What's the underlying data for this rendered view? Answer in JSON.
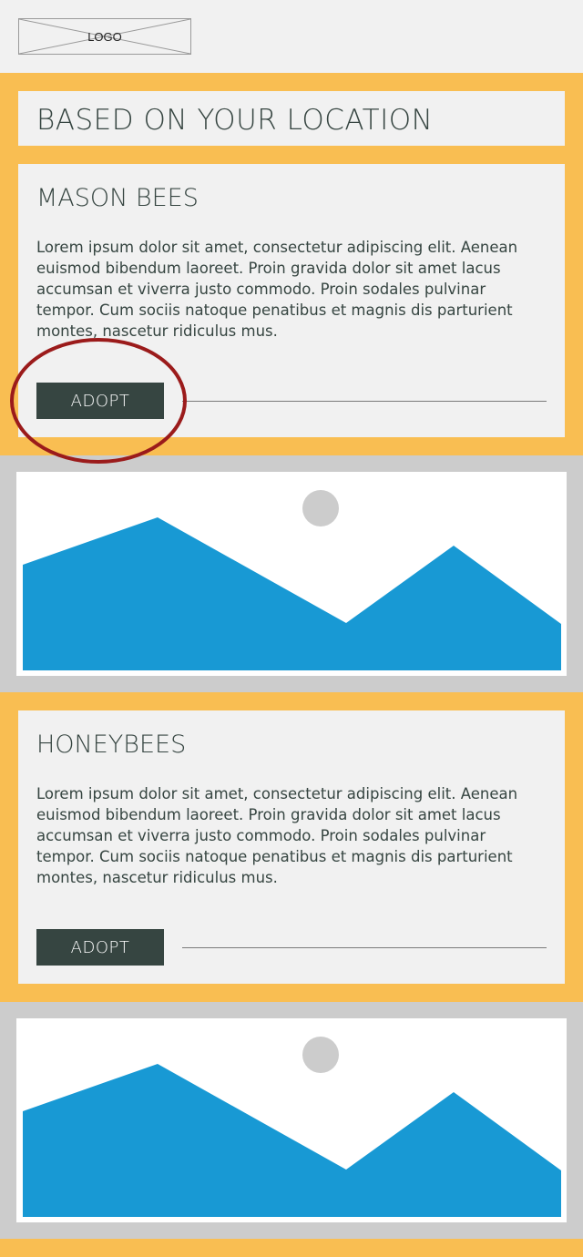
{
  "header": {
    "logo_text": "LOGO"
  },
  "section": {
    "title": "BASED ON YOUR LOCATION"
  },
  "cards": [
    {
      "title": "MASON BEES",
      "body": "Lorem ipsum dolor sit amet, consectetur adipiscing elit. Aenean euismod bibendum laoreet. Proin gravida dolor sit amet lacus accumsan et viverra justo commodo. Proin sodales pulvinar tempor. Cum sociis natoque penatibus et magnis dis parturient montes, nascetur ridiculus mus.",
      "button_label": "ADOPT",
      "highlighted": true
    },
    {
      "title": "HONEYBEES",
      "body": "Lorem ipsum dolor sit amet, consectetur adipiscing elit. Aenean euismod bibendum laoreet. Proin gravida dolor sit amet lacus accumsan et viverra justo commodo. Proin sodales pulvinar tempor. Cum sociis natoque penatibus et magnis dis parturient montes, nascetur ridiculus mus.",
      "button_label": "ADOPT",
      "highlighted": false
    }
  ],
  "image_placeholders": [
    {
      "icon": "image-placeholder-icon"
    },
    {
      "icon": "image-placeholder-icon"
    }
  ],
  "colors": {
    "accent_orange": "#f9be52",
    "separator_gray": "#cccccc",
    "panel": "#f1f1f1",
    "button_dark": "#364541",
    "mountain_blue": "#1899d4",
    "sun_gray": "#cccccc",
    "highlight_circle": "#9b1b1b"
  }
}
